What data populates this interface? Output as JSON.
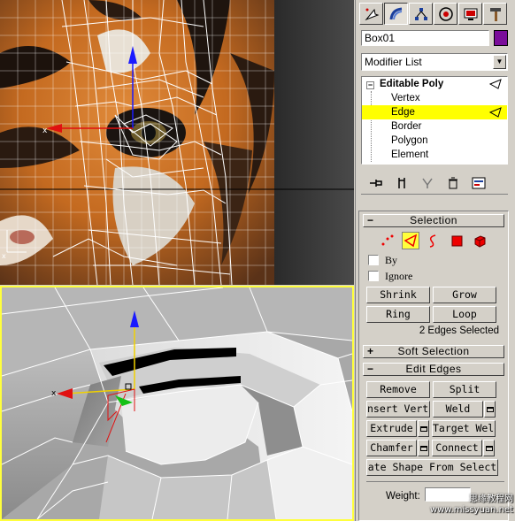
{
  "object": {
    "name": "Box01",
    "color": "#7a0d9a"
  },
  "modifier_list": {
    "label": "Modifier List"
  },
  "stack": {
    "root": "Editable Poly",
    "subobjects": [
      "Vertex",
      "Edge",
      "Border",
      "Polygon",
      "Element"
    ],
    "selected": "Edge"
  },
  "panel_tabs": [
    "create-icon",
    "modify-icon",
    "hierarchy-icon",
    "motion-icon",
    "display-icon",
    "utilities-icon"
  ],
  "selection": {
    "title": "Selection",
    "by_label": "By",
    "ignore_label": "Ignore",
    "buttons": {
      "shrink": "Shrink",
      "grow": "Grow",
      "ring": "Ring",
      "loop": "Loop"
    },
    "status": "2 Edges Selected"
  },
  "soft_selection": {
    "title": "Soft Selection"
  },
  "edit_edges": {
    "title": "Edit Edges",
    "buttons": {
      "remove": "Remove",
      "split": "Split",
      "insert_vertex": "nsert Verte",
      "weld": "Weld",
      "extrude": "Extrude",
      "target_weld": "Target Weld",
      "chamfer": "Chamfer",
      "connect": "Connect",
      "create_shape": "ate Shape From Select"
    },
    "weight_label": "Weight:"
  },
  "watermark": {
    "line1": "思缘教程网",
    "line2": "www.missyuan.net"
  },
  "colors": {
    "selection_highlight": "#ffff00",
    "viewport_active_border": "#ffff3c"
  }
}
